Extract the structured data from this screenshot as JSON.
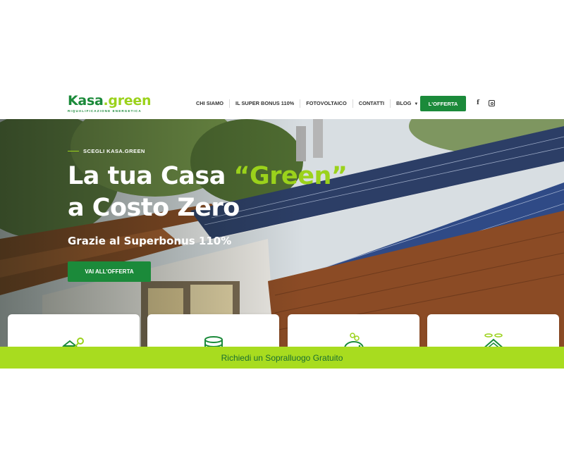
{
  "brand": {
    "logo_part1": "Kasa",
    "logo_dot": ".",
    "logo_part2": "green",
    "tagline": "RIQUALIFICAZIONE ENERGETICA"
  },
  "nav": {
    "items": [
      {
        "label": "CHI SIAMO"
      },
      {
        "label": "IL SUPER BONUS 110%"
      },
      {
        "label": "FOTOVOLTAICO"
      },
      {
        "label": "CONTATTI"
      },
      {
        "label": "BLOG"
      }
    ],
    "cta_label": "L'OFFERTA",
    "social": [
      "facebook-icon",
      "instagram-icon"
    ]
  },
  "hero": {
    "eyebrow": "SCEGLI KASA.GREEN",
    "headline_part1": "La tua Casa ",
    "headline_accent": "“Green”",
    "headline_part2": "a Costo Zero",
    "subheadline": "Grazie al Superbonus 110%",
    "button_label": "VAI ALL'OFFERTA"
  },
  "cards": [
    {
      "icon": "key-house-icon"
    },
    {
      "icon": "coins-icon"
    },
    {
      "icon": "piggy-bank-icon"
    },
    {
      "icon": "house-coins-icon"
    }
  ],
  "bottom_bar": {
    "label": "Richiedi un Sopralluogo Gratuito"
  },
  "colors": {
    "brand_green": "#1b8a3a",
    "accent_lime": "#9bd21b",
    "bar_lime": "#a8dc1f"
  }
}
